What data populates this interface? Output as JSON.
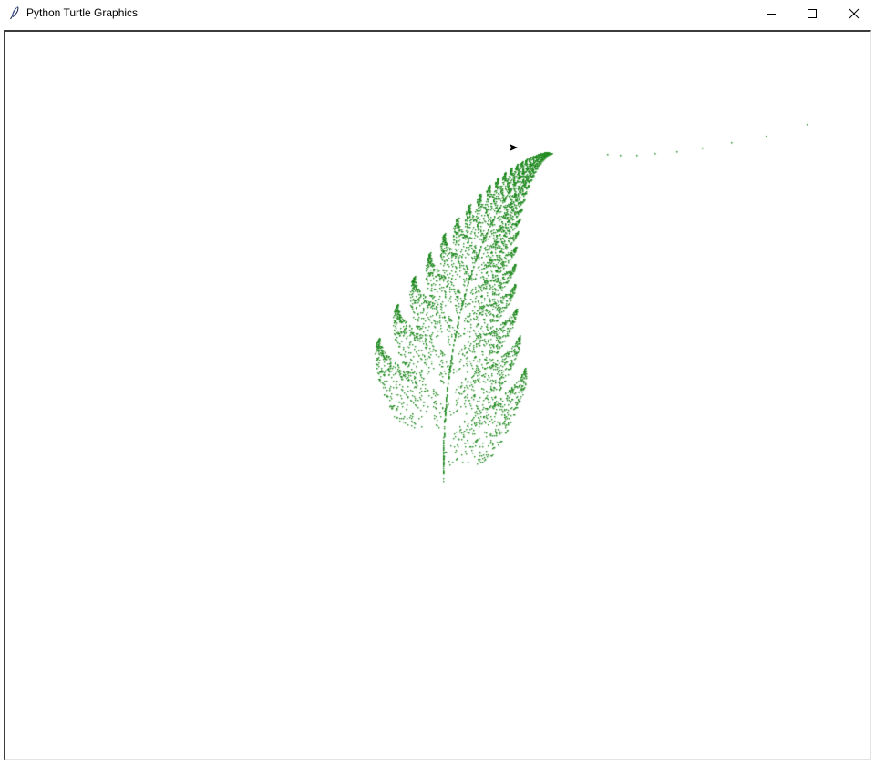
{
  "window": {
    "title": "Python Turtle Graphics",
    "icon": "feather-icon"
  },
  "controls": {
    "minimize_icon": "minimize-icon",
    "maximize_icon": "maximize-icon",
    "close_icon": "close-icon"
  },
  "canvas": {
    "background": "#ffffff",
    "fern_color": "#228b22",
    "turtle_color": "#000000",
    "drawing": "barnsley-fern"
  }
}
